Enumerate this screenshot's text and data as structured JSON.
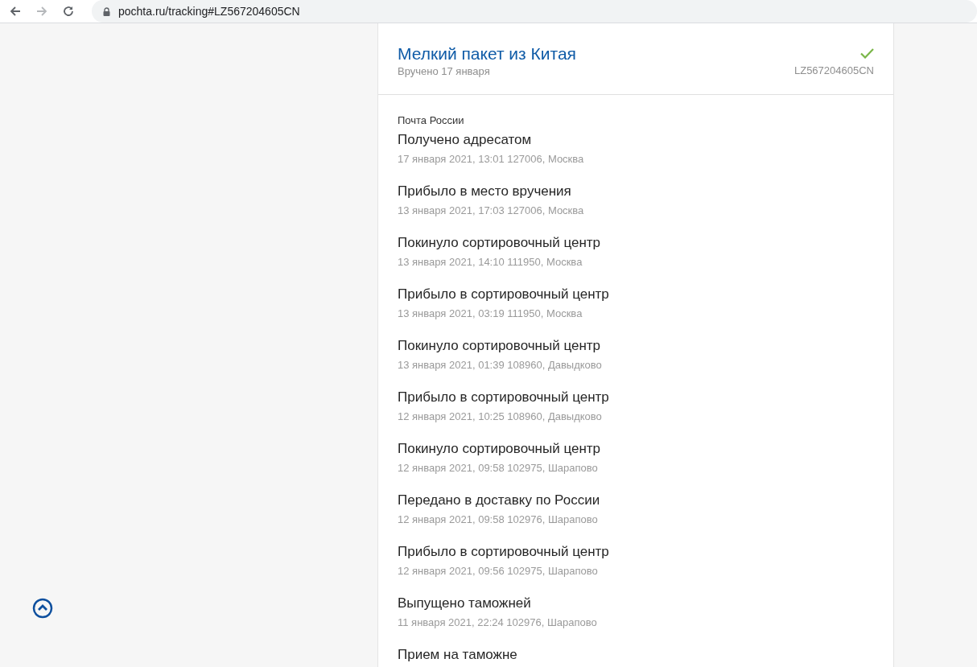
{
  "browser": {
    "url": "pochta.ru/tracking#LZ567204605CN"
  },
  "parcel": {
    "title": "Мелкий пакет из Китая",
    "status": "Вручено 17 января",
    "delivered": true,
    "track_number": "LZ567204605CN"
  },
  "carrier": "Почта России",
  "events": [
    {
      "title": "Получено адресатом",
      "details": "17 января 2021, 13:01 127006, Москва"
    },
    {
      "title": "Прибыло в место вручения",
      "details": "13 января 2021, 17:03 127006, Москва"
    },
    {
      "title": "Покинуло сортировочный центр",
      "details": "13 января 2021, 14:10 111950, Москва"
    },
    {
      "title": "Прибыло в сортировочный центр",
      "details": "13 января 2021, 03:19 111950, Москва"
    },
    {
      "title": "Покинуло сортировочный центр",
      "details": "13 января 2021, 01:39 108960, Давыдково"
    },
    {
      "title": "Прибыло в сортировочный центр",
      "details": "12 января 2021, 10:25 108960, Давыдково"
    },
    {
      "title": "Покинуло сортировочный центр",
      "details": "12 января 2021, 09:58 102975, Шарапово"
    },
    {
      "title": "Передано в доставку по России",
      "details": "12 января 2021, 09:58 102976, Шарапово"
    },
    {
      "title": "Прибыло в сортировочный центр",
      "details": "12 января 2021, 09:56 102975, Шарапово"
    },
    {
      "title": "Выпущено таможней",
      "details": "11 января 2021, 22:24 102976, Шарапово"
    },
    {
      "title": "Прием на таможне"
    }
  ]
}
